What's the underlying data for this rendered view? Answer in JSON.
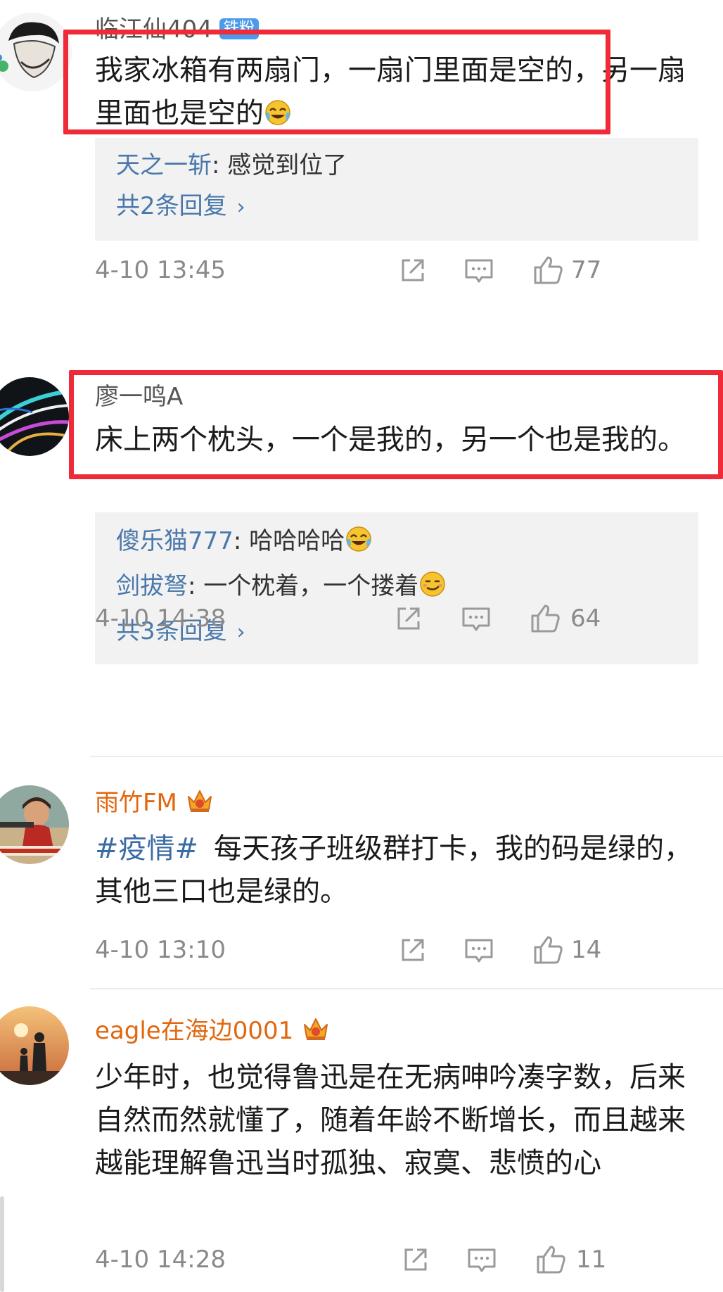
{
  "comments": [
    {
      "username": "临江仙404",
      "badge": "铁粉",
      "text": "我家冰箱有两扇门，一扇门里面是空的，另一扇里面也是空的",
      "emoji": "laughing-tears-emoji",
      "replies": [
        {
          "user": "天之一斩",
          "text": ": 感觉到位了"
        }
      ],
      "more_replies": "共2条回复",
      "time": "4-10 13:45",
      "likes": "77"
    },
    {
      "username": "廖一鸣A",
      "text": "床上两个枕头，一个是我的，另一个也是我的。",
      "replies": [
        {
          "user": "傻乐猫777",
          "text": ": 哈哈哈哈",
          "emoji": "laughing-tears-emoji"
        },
        {
          "user": "剑拔弩",
          "text": ": 一个枕着，一个搂着",
          "emoji": "smirk-emoji"
        }
      ],
      "more_replies": "共3条回复",
      "time": "4-10 14:38",
      "likes": "64"
    },
    {
      "username": "雨竹FM",
      "hashtag": "#疫情#",
      "text": "每天孩子班级群打卡，我的码是绿的，其他三口也是绿的。",
      "time": "4-10 13:10",
      "likes": "14"
    },
    {
      "username": "eagle在海边0001",
      "text": "少年时，也觉得鲁迅是在无病呻吟凑字数，后来自然而然就懂了，随着年龄不断增长，而且越来越能理解鲁迅当时孤独、寂寞、悲愤的心",
      "time": "4-10 14:28",
      "likes": "11"
    }
  ],
  "icons": {
    "repost": "repost-icon",
    "comment": "comment-icon",
    "like": "thumbs-up-icon",
    "crown": "vip-crown-icon"
  },
  "colors": {
    "highlight_box": "#ef2b3a",
    "link_blue": "#4a78ab",
    "vip_orange": "#e1670e",
    "reply_bg": "#f2f2f2",
    "meta_gray": "#8a8a8a"
  }
}
